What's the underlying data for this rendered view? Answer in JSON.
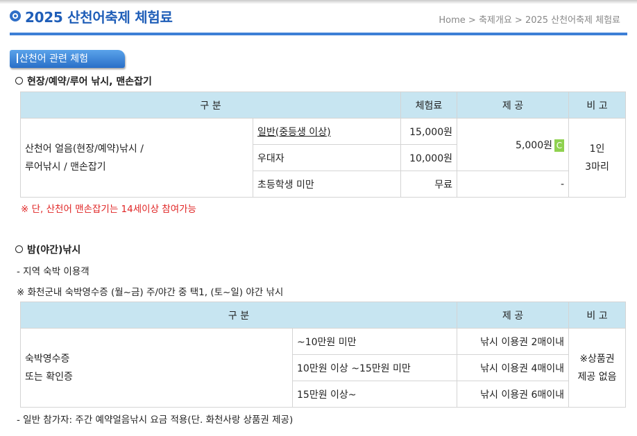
{
  "header": {
    "title": "2025 산천어축제 체험료",
    "breadcrumb": [
      "Home",
      ">",
      "축제개요",
      ">",
      "2025 산천어축제 체험료"
    ]
  },
  "section_tab": "산천어 관련 체험",
  "fishing": {
    "heading": "현장/예약/루어 낚시, 맨손잡기",
    "table": {
      "headers": [
        "구 분",
        "체험료",
        "제 공",
        "비 고"
      ],
      "category_line1": "산천어 얼음(현장/예약)낚시 /",
      "category_line2": "루어낚시 / 맨손잡기",
      "rows": [
        {
          "type": "일반(중등생 이상)",
          "fee": "15,000원"
        },
        {
          "type": "우대자",
          "fee": "10,000원"
        },
        {
          "type": "초등학생 미만",
          "fee": "무료",
          "provide": "-"
        }
      ],
      "provide": "5,000원",
      "provide_badge": "C",
      "note_line1": "1인",
      "note_line2": "3마리"
    },
    "notice": "※ 단, 산천어 맨손잡기는 14세이상 참여가능"
  },
  "night": {
    "heading": "밤(야간)낚시",
    "line1": "- 지역 숙박 이용객",
    "line2": "※ 화천군내 숙박영수증 (월~금) 주/야간 중 택1, (토~일) 야간 낚시",
    "table": {
      "headers": [
        "구 분",
        "제 공",
        "비 고"
      ],
      "category_line1": "숙박영수증",
      "category_line2": "또는 확인증",
      "rows": [
        {
          "range": "~10만원 미만",
          "provide": "낚시 이용권 2매이내"
        },
        {
          "range": "10만원 이상 ~15만원 미만",
          "provide": "낚시 이용권 4매이내"
        },
        {
          "range": "15만원 이상~",
          "provide": "낚시 이용권 6매이내"
        }
      ],
      "note_line1": "※상품권",
      "note_line2": "제공 없음"
    },
    "footer": "- 일반 참가자: 주간 예약얼음낚시 요금 적용(단. 화천사랑 상품권 제공)"
  },
  "colors": {
    "title": "#1f5eb8",
    "header_line": "#3d7fd6",
    "table_header_bg": "#c7e5f1",
    "notice_red": "#e02424",
    "badge_green": "#8fd14f"
  }
}
